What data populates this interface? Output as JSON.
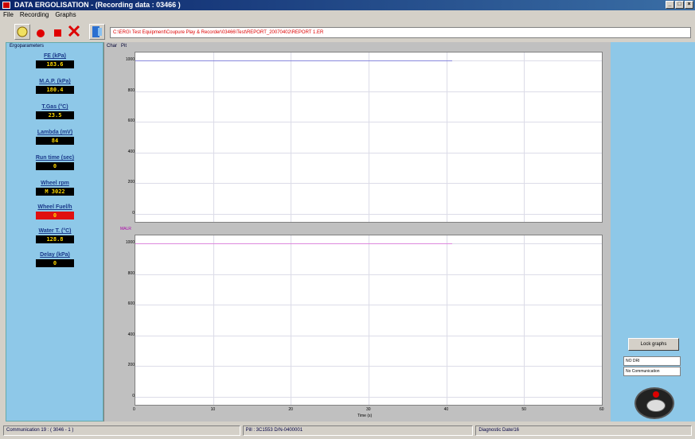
{
  "window": {
    "title": "DATA ERGOLISATION - (Recording data : 03466 )"
  },
  "menu": [
    "File",
    "Recording",
    "Graphs"
  ],
  "toolbar": {
    "buttons": [
      "open-icon",
      "record-icon",
      "stop-icon",
      "delete-icon",
      "exit-icon"
    ],
    "alert_text": "C:\\ERG\\ Test Equipment\\Coupure Play & Recorder\\03466\\Test\\REPORT_20070402\\REPORT 1.ER"
  },
  "left_panel": {
    "title": "Ergoparameters",
    "gauges": [
      {
        "label": "FE (kPa)",
        "value": "183.6",
        "alarm": false
      },
      {
        "label": "M.A.P. (kPa)",
        "value": "180.4",
        "alarm": false
      },
      {
        "label": "T.Gas (°C)",
        "value": "23.5",
        "alarm": false
      },
      {
        "label": "Lambda (mV)",
        "value": "84",
        "alarm": false
      },
      {
        "label": "Run time (sec)",
        "value": "0",
        "alarm": false
      },
      {
        "label": "Wheel rpm",
        "value": "M 3022",
        "alarm": false
      },
      {
        "label": "Wheel Fuel/h",
        "value": "0",
        "alarm": true
      },
      {
        "label": "Water T. (°C)",
        "value": "128.8",
        "alarm": false
      },
      {
        "label": "Delay (kPa)",
        "value": "0",
        "alarm": false
      }
    ]
  },
  "chart_data": [
    {
      "type": "line",
      "tabs": [
        "Char",
        "Pit"
      ],
      "y_ticks": [
        "1000",
        "800",
        "600",
        "400",
        "200",
        "0"
      ],
      "series": [
        {
          "values_note": "flat",
          "color": "#8888dd"
        }
      ],
      "x_ticks": [],
      "ylim": [
        0,
        1000
      ],
      "line_level": 1000,
      "line_end_fraction": 0.68
    },
    {
      "type": "line",
      "legend": "MALR",
      "y_ticks": [
        "1000",
        "800",
        "600",
        "400",
        "200",
        "0"
      ],
      "x_ticks": [
        "0",
        "10",
        "20",
        "30",
        "40",
        "50",
        "60"
      ],
      "xlabel": "Time (s)",
      "series": [
        {
          "color": "#dd88dd"
        }
      ],
      "ylim": [
        0,
        1000
      ],
      "line_level": 1000,
      "line_end_fraction": 0.68
    }
  ],
  "right_panel": {
    "lock_button": "Lock graphs",
    "status1": "NO DRI",
    "status2": "No Communication"
  },
  "statusbar": {
    "cell1": "Communication 19 : ( 3046 - 1 )",
    "cell2": "Pill  : 3C1553    D/N-0400001",
    "cell3": "Diagnostic Date/16"
  }
}
